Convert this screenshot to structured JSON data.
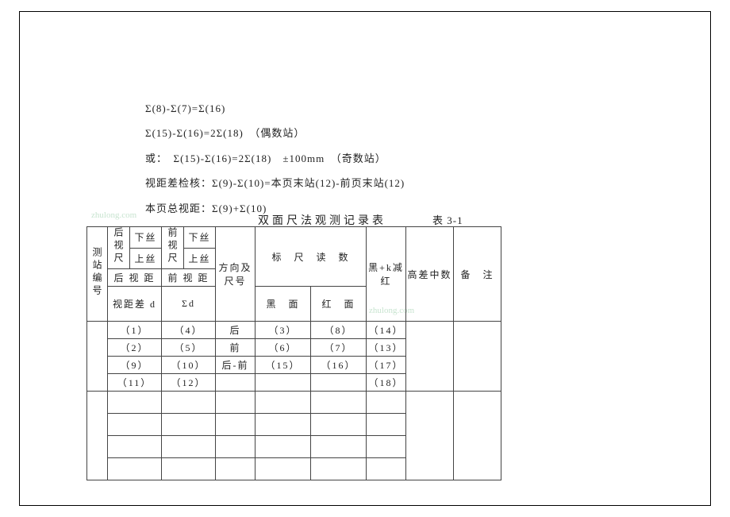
{
  "formulas": {
    "line1": "Σ(8)-Σ(7)=Σ(16)",
    "line2": "Σ(15)-Σ(16)=2Σ(18)　（偶数站）",
    "line3": "或：　Σ(15)-Σ(16)=2Σ(18)　±100mm　（奇数站）",
    "line4": "视距差检核：Σ(9)-Σ(10)=本页末站(12)-前页末站(12)",
    "line5": "本页总视距：Σ(9)+Σ(10)"
  },
  "title": "双面尺法观测记录表",
  "table_num": "表 3-1",
  "header": {
    "station": "测站编号",
    "back_ruler": "后视尺",
    "front_ruler": "前视尺",
    "down_thread": "下丝",
    "up_thread": "上丝",
    "back_dist": "后 视 距",
    "front_dist": "前 视 距",
    "dist_diff": "视距差 d",
    "sigma_d": "Σd",
    "direction": "方向及尺号",
    "ruler_reading": "标　尺　读　数",
    "black_face": "黑　面",
    "red_face": "红　面",
    "black_k_red": "黑+k减红",
    "height_diff": "高差中数",
    "remark": "备　注"
  },
  "body": {
    "r1": {
      "c1": "（1）",
      "c2": "（4）",
      "c3": "后",
      "c4": "（3）",
      "c5": "（8）",
      "c6": "（14）"
    },
    "r2": {
      "c1": "（2）",
      "c2": "（5）",
      "c3": "前",
      "c4": "（6）",
      "c5": "（7）",
      "c6": "（13）"
    },
    "r3": {
      "c1": "（9）",
      "c2": "（10）",
      "c3": "后-前",
      "c4": "（15）",
      "c5": "（16）",
      "c6": "（17）",
      "c7": "（18）"
    },
    "r4": {
      "c1": "（11）",
      "c2": "（12）"
    }
  },
  "watermark": "zhulong.com"
}
